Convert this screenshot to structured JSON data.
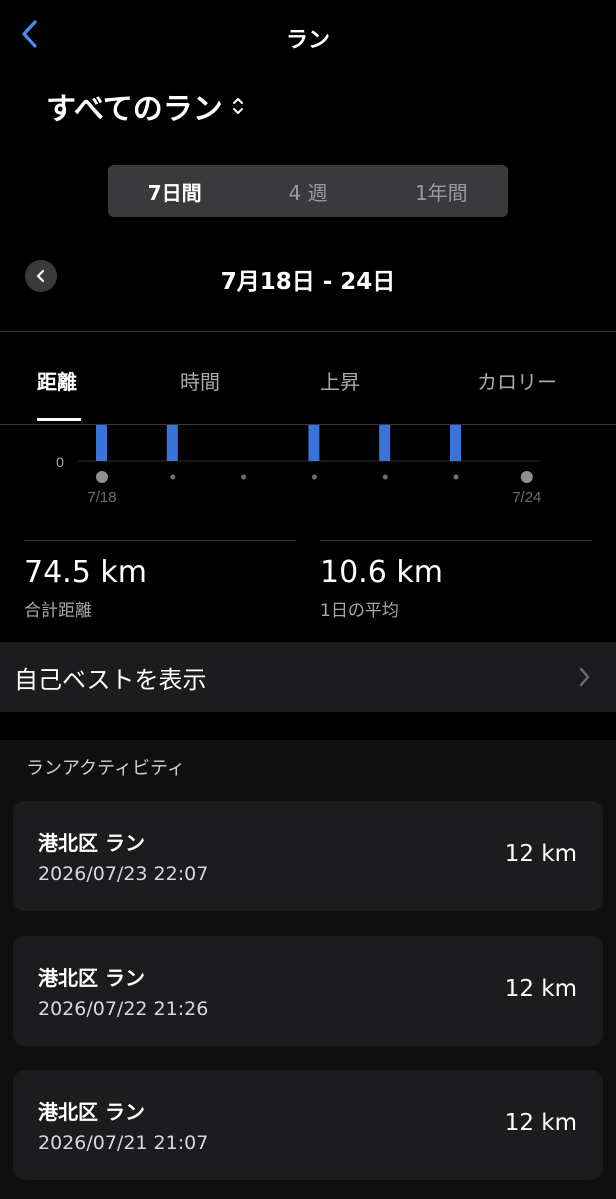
{
  "header": {
    "title": "ラン"
  },
  "filter": {
    "label": "すべてのラン"
  },
  "segments": [
    {
      "label": "7日間",
      "active": true
    },
    {
      "label": "4 週",
      "active": false
    },
    {
      "label": "1年間",
      "active": false
    }
  ],
  "range": {
    "title": "7月18日 - 24日"
  },
  "metric_tabs": [
    {
      "label": "距離",
      "active": true
    },
    {
      "label": "時間",
      "active": false
    },
    {
      "label": "上昇",
      "active": false
    },
    {
      "label": "カロリー",
      "active": false
    }
  ],
  "chart_data": {
    "type": "bar",
    "categories": [
      "7/18",
      "7/19",
      "7/20",
      "7/21",
      "7/22",
      "7/23",
      "7/24"
    ],
    "x_tick_labels": [
      "7/18",
      "",
      "",
      "",
      "",
      "",
      "7/24"
    ],
    "y_tick_labels": [
      "0"
    ],
    "values": [
      null,
      null,
      null,
      null,
      null,
      null,
      null
    ],
    "has_bar": [
      true,
      true,
      false,
      true,
      true,
      true,
      false
    ],
    "accent_color": "#3a73d9"
  },
  "stats": {
    "total": {
      "value": "74.5 km",
      "label": "合計距離"
    },
    "average": {
      "value": "10.6 km",
      "label": "1日の平均"
    }
  },
  "personal_best": {
    "label": "自己ベストを表示"
  },
  "activity": {
    "heading": "ランアクティビティ",
    "items": [
      {
        "title": "港北区 ラン",
        "datetime": "2026/07/23 22:07",
        "distance": "12 km"
      },
      {
        "title": "港北区 ラン",
        "datetime": "2026/07/22 21:26",
        "distance": "12 km"
      },
      {
        "title": "港北区 ラン",
        "datetime": "2026/07/21 21:07",
        "distance": "12 km"
      }
    ]
  },
  "colors": {
    "accent": "#3a73d9",
    "back": "#4a8df0"
  }
}
